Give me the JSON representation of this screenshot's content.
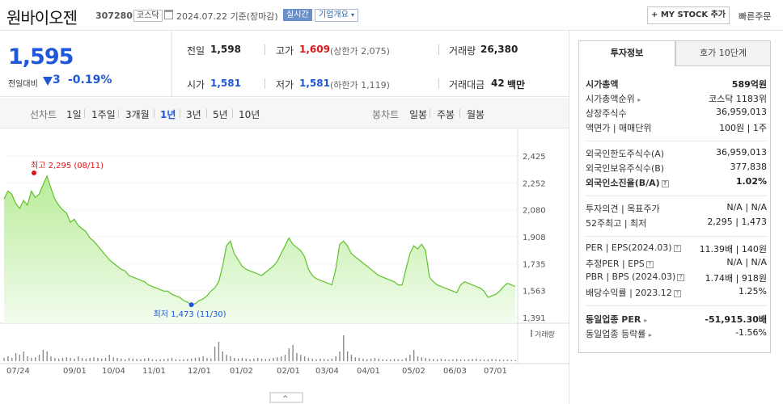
{
  "header": {
    "stock_name": "원바이오젠",
    "stock_code": "307280",
    "market": "코스닥",
    "date_text": "2024.07.22 기준(장마감)",
    "realtime": "실시간",
    "company_info": "기업개요",
    "mystock": "+ MY STOCK 추가",
    "quick_order": "빠른주문"
  },
  "price": {
    "now": "1,595",
    "vs_label": "전일대비",
    "change": "3",
    "change_pct": "-0.19%"
  },
  "summary": {
    "prev_label": "전일",
    "prev": "1,598",
    "high_label": "고가",
    "high": "1,609",
    "upper_limit": "(상한가 2,075)",
    "volume_label": "거래량",
    "volume": "26,380",
    "open_label": "시가",
    "open": "1,581",
    "low_label": "저가",
    "low": "1,581",
    "lower_limit": "(하한가 1,119)",
    "amount_label": "거래대금",
    "amount": "42",
    "amount_unit": "백만"
  },
  "period": {
    "line_label": "선차트",
    "line_items": [
      "1일",
      "1주일",
      "3개월",
      "1년",
      "3년",
      "5년",
      "10년"
    ],
    "candle_label": "봉차트",
    "candle_items": [
      "일봉",
      "주봉",
      "월봉"
    ]
  },
  "chart_data": {
    "type": "area",
    "y_ticks": [
      "2,425",
      "2,252",
      "2,080",
      "1,908",
      "1,735",
      "1,563",
      "1,391"
    ],
    "ylim": [
      1391,
      2425
    ],
    "x_ticks": [
      "07/24",
      "09/01",
      "10/04",
      "11/01",
      "12/01",
      "01/02",
      "02/01",
      "03/04",
      "04/01",
      "05/02",
      "06/03",
      "07/01"
    ],
    "high_label": "최고 2,295 (08/11)",
    "low_label": "최저 1,473 (11/30)",
    "volume_label": "거래량",
    "series": [
      {
        "values": [
          2150,
          2200,
          2180,
          2120,
          2090,
          2140,
          2110,
          2200,
          2160,
          2180,
          2240,
          2295,
          2220,
          2150,
          2110,
          2080,
          2060,
          2000,
          2020,
          1980,
          1960,
          1940,
          1900,
          1880,
          1850,
          1820,
          1790,
          1760,
          1740,
          1720,
          1700,
          1690,
          1660,
          1650,
          1640,
          1630,
          1620,
          1600,
          1590,
          1580,
          1570,
          1560,
          1560,
          1540,
          1530,
          1520,
          1500,
          1490,
          1473,
          1480,
          1500,
          1510,
          1530,
          1560,
          1580,
          1620,
          1720,
          1850,
          1880,
          1800,
          1760,
          1720,
          1700,
          1690,
          1680,
          1670,
          1660,
          1680,
          1700,
          1720,
          1750,
          1800,
          1850,
          1900,
          1860,
          1840,
          1820,
          1780,
          1700,
          1660,
          1640,
          1630,
          1620,
          1610,
          1600,
          1700,
          1860,
          1880,
          1850,
          1800,
          1780,
          1760,
          1740,
          1720,
          1700,
          1680,
          1660,
          1650,
          1640,
          1630,
          1620,
          1600,
          1600,
          1700,
          1800,
          1850,
          1830,
          1860,
          1820,
          1650,
          1620,
          1600,
          1590,
          1580,
          1570,
          1560,
          1550,
          1600,
          1620,
          1610,
          1600,
          1590,
          1580,
          1560,
          1520,
          1530,
          1540,
          1560,
          1590,
          1610,
          1600,
          1590
        ]
      }
    ],
    "volumes": [
      0.1,
      0.15,
      0.1,
      0.25,
      0.2,
      0.3,
      0.15,
      0.1,
      0.12,
      0.2,
      0.35,
      0.3,
      0.15,
      0.1,
      0.08,
      0.1,
      0.12,
      0.1,
      0.08,
      0.15,
      0.1,
      0.08,
      0.1,
      0.12,
      0.1,
      0.08,
      0.1,
      0.2,
      0.12,
      0.1,
      0.08,
      0.06,
      0.1,
      0.08,
      0.07,
      0.06,
      0.08,
      0.1,
      0.06,
      0.05,
      0.06,
      0.07,
      0.08,
      0.1,
      0.06,
      0.05,
      0.06,
      0.07,
      0.08,
      0.1,
      0.12,
      0.15,
      0.1,
      0.08,
      0.45,
      0.6,
      0.3,
      0.2,
      0.15,
      0.1,
      0.08,
      0.1,
      0.08,
      0.06,
      0.08,
      0.1,
      0.08,
      0.07,
      0.08,
      0.1,
      0.12,
      0.15,
      0.2,
      0.4,
      0.5,
      0.25,
      0.2,
      0.15,
      0.1,
      0.08,
      0.06,
      0.08,
      0.07,
      0.06,
      0.08,
      0.15,
      0.3,
      0.8,
      0.3,
      0.2,
      0.12,
      0.1,
      0.08,
      0.06,
      0.08,
      0.1,
      0.08,
      0.06,
      0.05,
      0.06,
      0.07,
      0.06,
      0.05,
      0.1,
      0.2,
      0.35,
      0.15,
      0.12,
      0.1,
      0.08,
      0.07,
      0.06,
      0.08,
      0.06,
      0.05,
      0.06,
      0.07,
      0.06,
      0.05,
      0.06,
      0.07,
      0.08,
      0.06,
      0.05,
      0.06,
      0.07,
      0.06,
      0.05,
      0.04,
      0.05,
      0.04,
      0.03
    ]
  },
  "panel": {
    "tab_active": "투자정보",
    "tab_inactive": "호가 10단계",
    "rows": [
      {
        "label": "시가총액",
        "value": "589억원"
      },
      {
        "label": "시가총액순위",
        "value": "코스닥 1183위"
      },
      {
        "label": "상장주식수",
        "value": "36,959,013"
      },
      {
        "label": "액면가 | 매매단위",
        "value": "100원 | 1주"
      },
      {
        "label": "외국인한도주식수(A)",
        "value": "36,959,013"
      },
      {
        "label": "외국인보유주식수(B)",
        "value": "377,838"
      },
      {
        "label": "외국인소진율(B/A)",
        "value": "1.02%"
      },
      {
        "label": "투자의견 | 목표주가",
        "value": "N/A | N/A"
      },
      {
        "label": "52주최고 | 최저",
        "value": "2,295 | 1,473"
      },
      {
        "label": "PER | EPS(2024.03)",
        "value": "11.39배 | 140원"
      },
      {
        "label": "추정PER | EPS",
        "value": "N/A | N/A"
      },
      {
        "label": "PBR | BPS (2024.03)",
        "value": "1.74배 | 918원"
      },
      {
        "label": "배당수익률 | 2023.12",
        "value": "1.25%"
      },
      {
        "label": "동일업종 PER",
        "value": "-51,915.30배"
      },
      {
        "label": "동일업종 등락률",
        "value": "-1.56%"
      }
    ]
  }
}
